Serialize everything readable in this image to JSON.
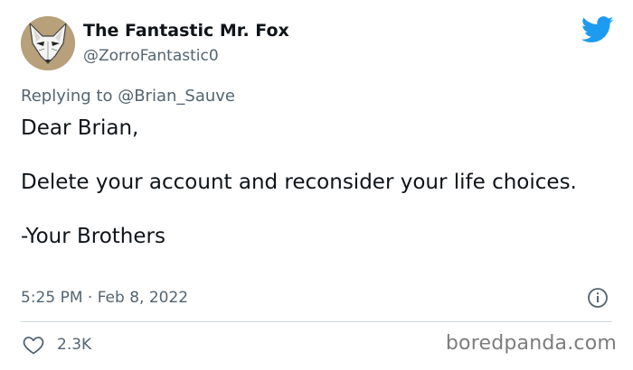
{
  "user": {
    "display_name": "The Fantastic Mr. Fox",
    "handle": "@ZorroFantastic0",
    "avatar_icon": "fox-mask-avatar"
  },
  "reply": {
    "prefix": "Replying to ",
    "mention": "@Brian_Sauve"
  },
  "tweet": {
    "line1": "Dear Brian,",
    "line2": "Delete your account and reconsider your life choices.",
    "line3": "-Your Brothers"
  },
  "meta": {
    "timestamp": "5:25 PM · Feb 8, 2022"
  },
  "stats": {
    "likes": "2.3K"
  },
  "watermark": "boredpanda.com",
  "colors": {
    "text": "#0f1419",
    "secondary": "#536471",
    "twitter_blue": "#1d9bf0",
    "divider": "#cfd9de"
  },
  "icons": {
    "brand": "twitter-bird-icon",
    "info": "info-icon",
    "like": "heart-icon"
  }
}
